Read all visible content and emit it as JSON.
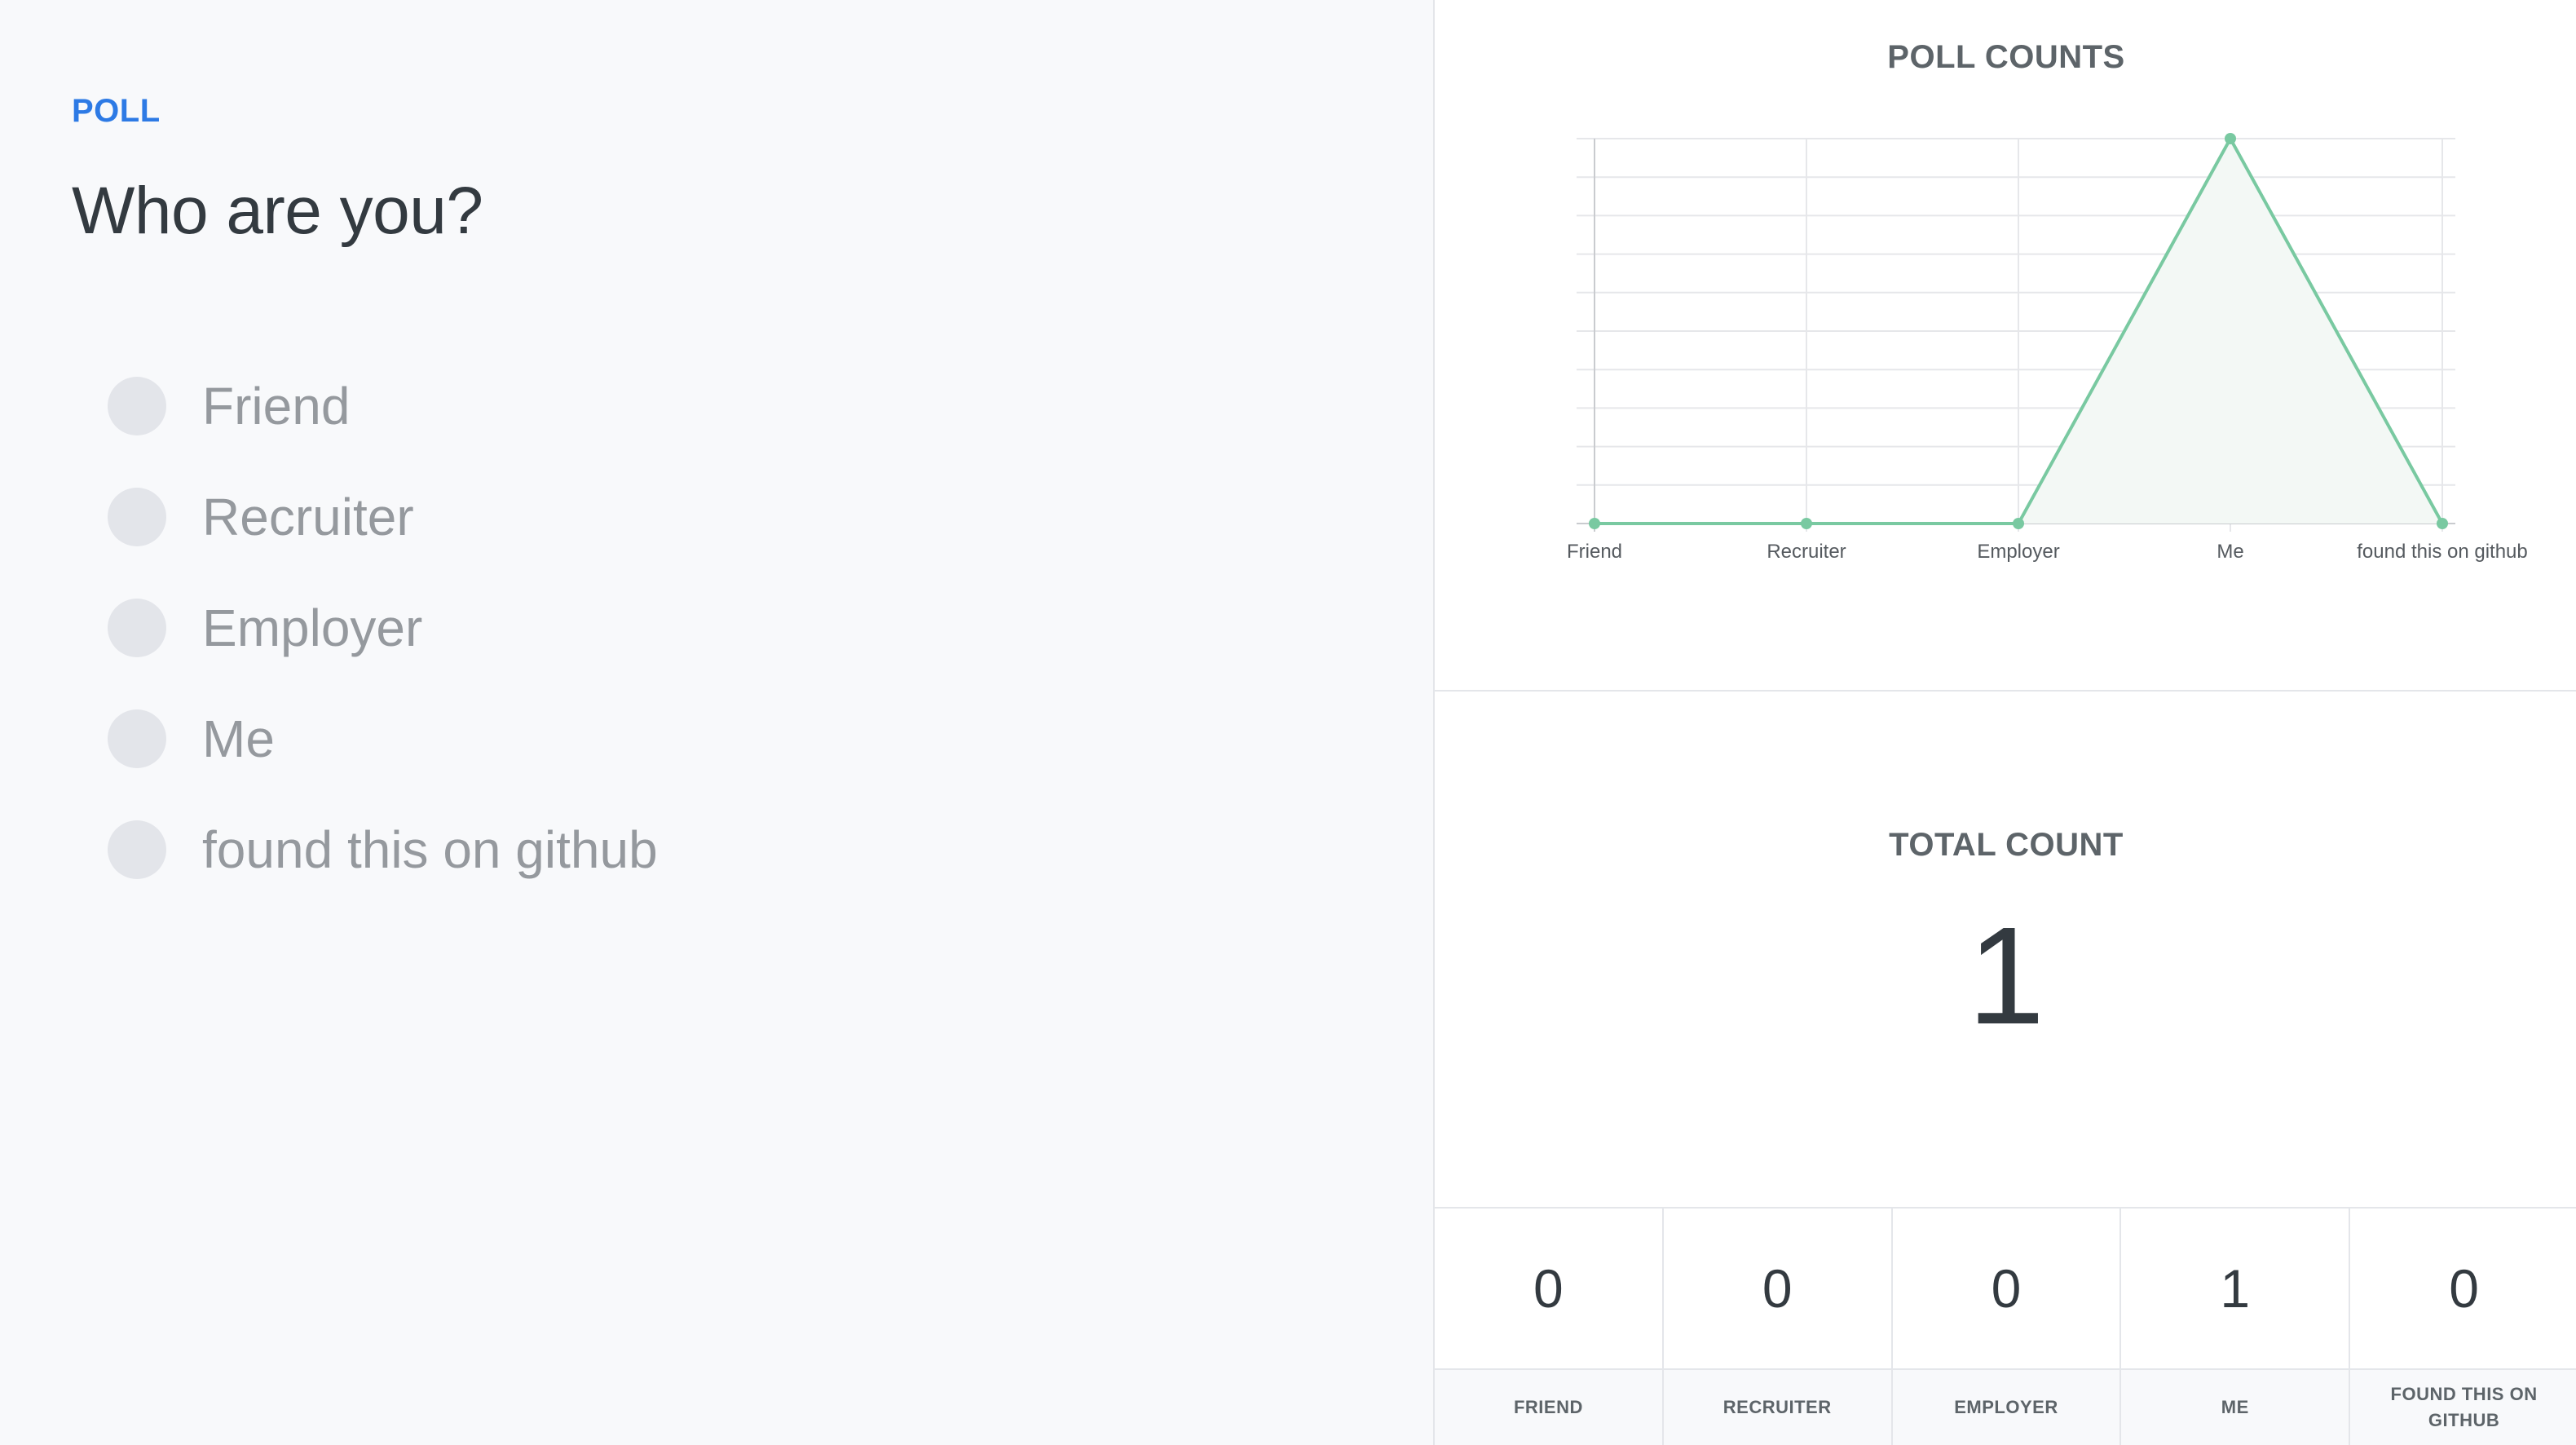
{
  "poll": {
    "label": "POLL",
    "question": "Who are you?",
    "options": [
      {
        "label": "Friend"
      },
      {
        "label": "Recruiter"
      },
      {
        "label": "Employer"
      },
      {
        "label": "Me"
      },
      {
        "label": "found this on github"
      }
    ]
  },
  "results": {
    "chart_title": "POLL COUNTS",
    "total_title": "TOTAL COUNT",
    "total_value": "1",
    "counts": [
      {
        "value": "0",
        "label": "FRIEND"
      },
      {
        "value": "0",
        "label": "RECRUITER"
      },
      {
        "value": "0",
        "label": "EMPLOYER"
      },
      {
        "value": "1",
        "label": "ME"
      },
      {
        "value": "0",
        "label": "FOUND THIS ON GITHUB"
      }
    ]
  },
  "colors": {
    "accent": "#2d7ae5",
    "line": "#79c9a1",
    "fill": "#f3f8f5"
  },
  "chart_data": {
    "type": "line",
    "title": "POLL COUNTS",
    "xlabel": "",
    "ylabel": "",
    "categories": [
      "Friend",
      "Recruiter",
      "Employer",
      "Me",
      "found this on github"
    ],
    "series": [
      {
        "values": [
          0,
          0,
          0,
          1,
          0
        ]
      }
    ],
    "ylim": [
      0,
      1
    ],
    "grid": true,
    "fill": true
  }
}
